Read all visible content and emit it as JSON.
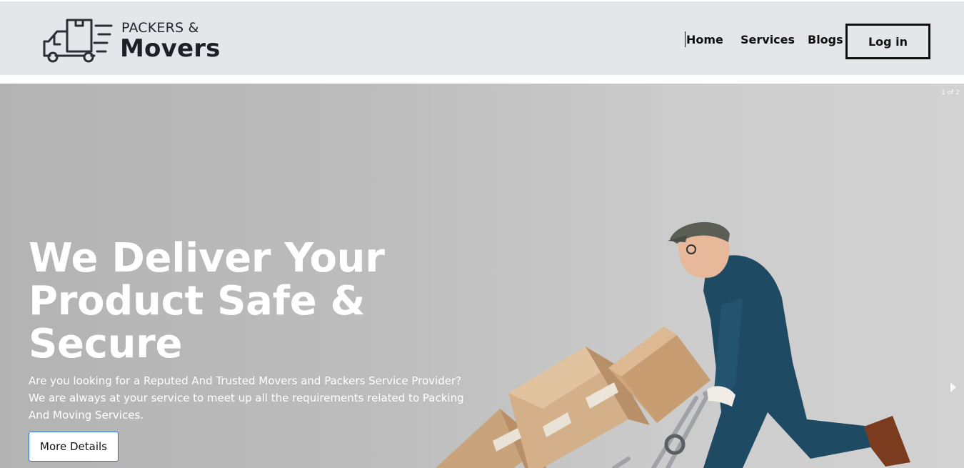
{
  "brand": {
    "top_text": "PACKERS &",
    "main_text": "Movers",
    "icon": "truck-icon"
  },
  "nav": {
    "home": "Home",
    "services": "Services",
    "blogs": "Blogs",
    "login": "Log in"
  },
  "hero": {
    "slide_counter": "1 of 2",
    "title_lines": [
      "We Deliver Your",
      "Product Safe &",
      "Secure"
    ],
    "description": "Are you looking for a Reputed And Trusted Movers and Packers Service Provider?We are always at your service to meet up all the requirements related to Packing And Moving Services.",
    "button_label": "More Details",
    "next_icon": "chevron-right-icon"
  },
  "colors": {
    "header_bg": "#e5e6ea",
    "hero_bg": "#bdbdbd",
    "uniform": "#1f4a63",
    "box": "#caa57e",
    "button_border": "#2e6fd0"
  }
}
